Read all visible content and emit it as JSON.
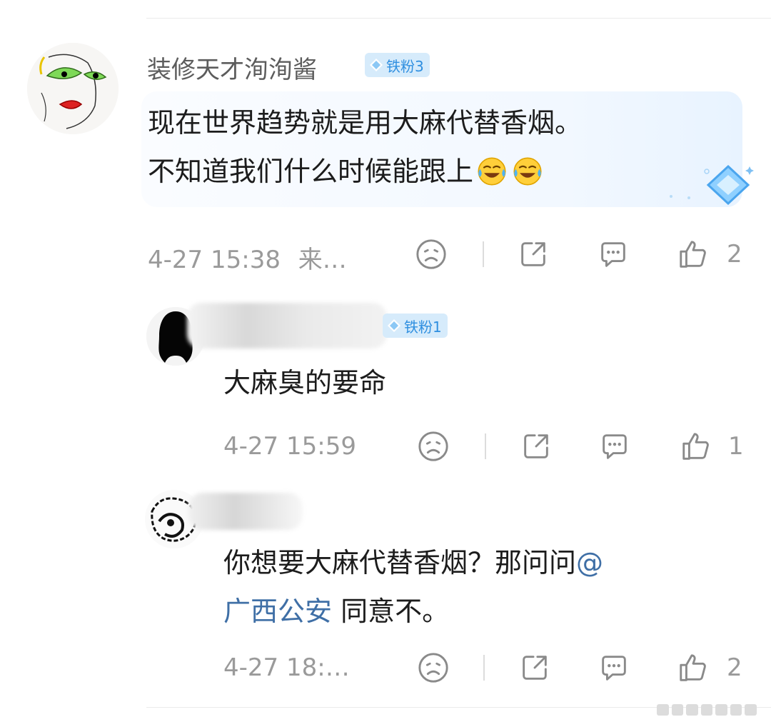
{
  "comments": [
    {
      "username": "装修天才洵洵酱",
      "badge": "铁粉3",
      "lines": [
        "现在世界趋势就是用大麻代替香烟。",
        "不知道我们什么时候能跟上"
      ],
      "emoji": "laughing-crying",
      "time": "4-27 15:38",
      "source": "来…",
      "likes": "2"
    },
    {
      "username": "",
      "badge": "铁粉1",
      "lines": [
        "大麻臭的要命"
      ],
      "time": "4-27 15:59",
      "likes": "1"
    },
    {
      "username": "",
      "lines": [
        "你想要大麻代替香烟？那问问"
      ],
      "mention_at": "@",
      "mention_name": "广西公安",
      "tail": " 同意不。",
      "time": "4-27 18:…",
      "likes": "2"
    }
  ],
  "icons": {
    "reaction": "sad-face-icon",
    "share": "share-icon",
    "comment": "comment-bubble-icon",
    "like": "thumbs-up-icon"
  },
  "colors": {
    "badge_bg": "#d6ebfb",
    "badge_text": "#2f8fe0",
    "mention": "#3f6fa6",
    "meta_gray": "#9a9a9a"
  }
}
